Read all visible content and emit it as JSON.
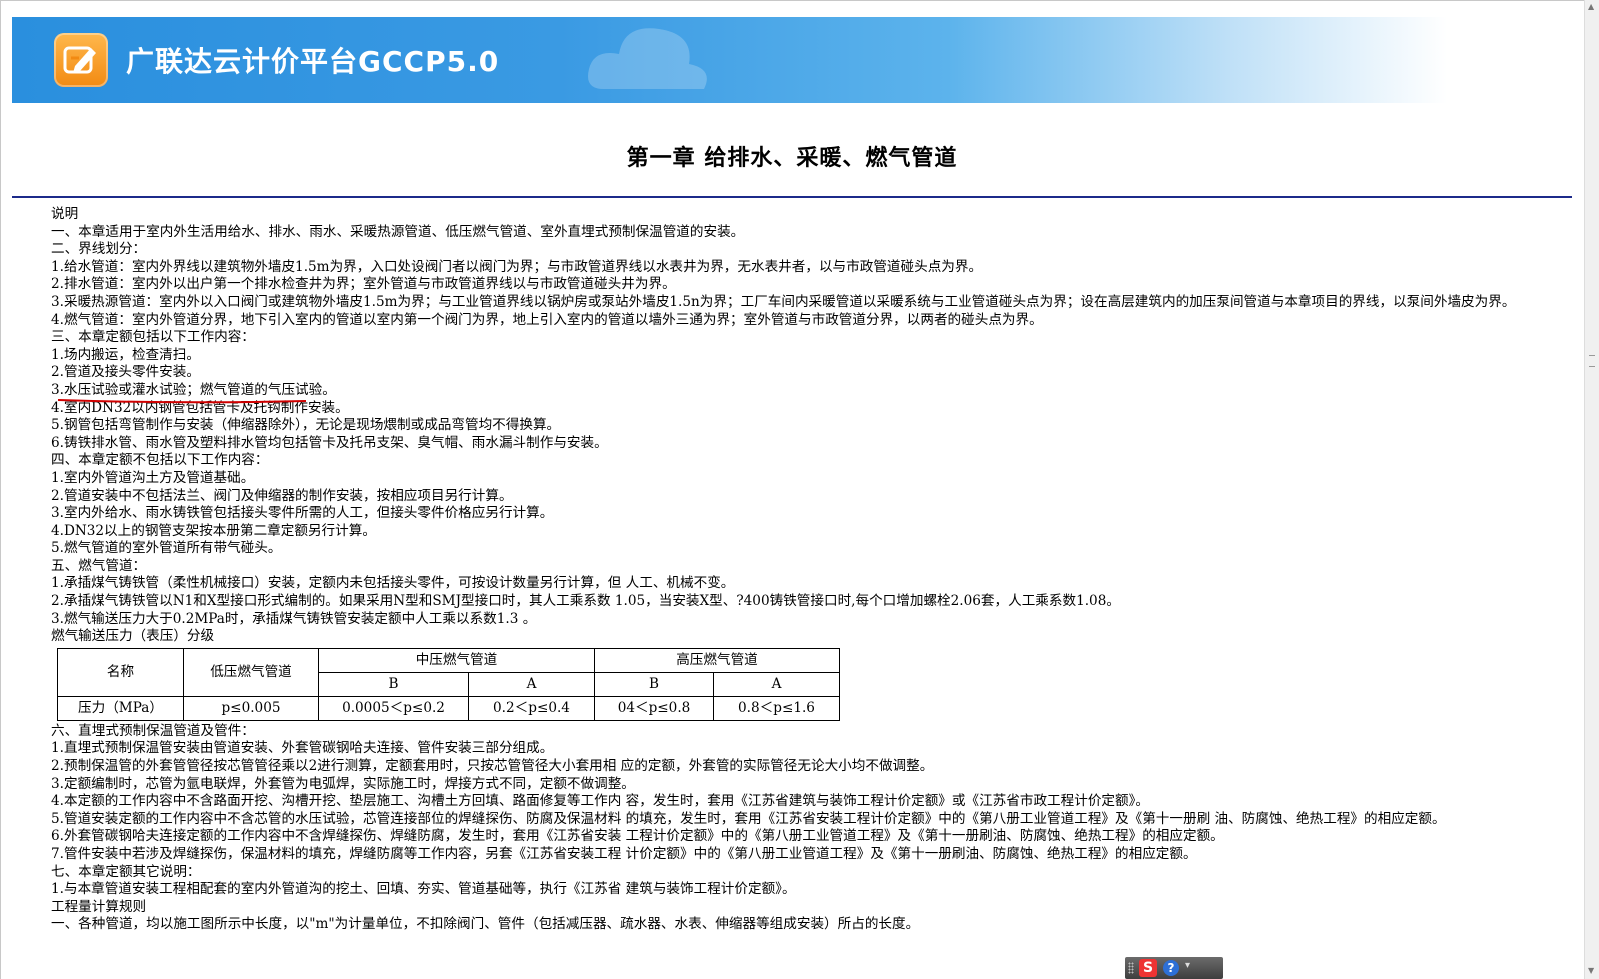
{
  "banner": {
    "title": "广联达云计价平台GCCP5.0"
  },
  "document": {
    "chapter_title": "第一章  给排水、采暖、燃气管道",
    "lines_before_table": [
      {
        "text": "说明"
      },
      {
        "text": "一、本章适用于室内外生活用给水、排水、雨水、采暖热源管道、低压燃气管道、室外直埋式预制保温管道的安装。"
      },
      {
        "text": "二、界线划分："
      },
      {
        "text": "1.给水管道：室内外界线以建筑物外墙皮1.5m为界，入口处设阀门者以阀门为界；与市政管道界线以水表井为界，无水表井者，以与市政管道碰头点为界。"
      },
      {
        "text": "2.排水管道：室内外以出户第一个排水检查井为界；室外管道与市政管道界线以与市政管道碰头井为界。"
      },
      {
        "text": "3.采暖热源管道：室内外以入口阀门或建筑物外墙皮1.5m为界；与工业管道界线以锅炉房或泵站外墙皮1.5n为界；工厂车间内采暖管道以采暖系统与工业管道碰头点为界；设在高层建筑内的加压泵间管道与本章项目的界线，以泵间外墙皮为界。",
        "wrap": true
      },
      {
        "text": "4.燃气管道：室内外管道分界，地下引入室内的管道以室内第一个阀门为界，地上引入室内的管道以墙外三通为界；室外管道与市政管道分界，以两者的碰头点为界。"
      },
      {
        "text": "三、本章定额包括以下工作内容："
      },
      {
        "text": "1.场内搬运，检查清扫。"
      },
      {
        "text": "2.管道及接头零件安装。"
      },
      {
        "text": "3.水压试验或灌水试验；燃气管道的气压试验。"
      },
      {
        "text": "4.室内DN32以内钢管包括管卡及托钩制作安装。"
      },
      {
        "text": "5.钢管包括弯管制作与安装（伸缩器除外），无论是现场煨制或成品弯管均不得换算。"
      },
      {
        "text": "6.铸铁排水管、雨水管及塑料排水管均包括管卡及托吊支架、臭气帽、雨水漏斗制作与安装。"
      },
      {
        "text": "四、本章定额不包括以下工作内容："
      },
      {
        "text": "1.室内外管道沟土方及管道基础。"
      },
      {
        "text": "2.管道安装中不包括法兰、阀门及伸缩器的制作安装，按相应项目另行计算。"
      },
      {
        "text": "3.室内外给水、雨水铸铁管包括接头零件所需的人工，但接头零件价格应另行计算。"
      },
      {
        "text": "4.DN32以上的钢管支架按本册第二章定额另行计算。"
      },
      {
        "text": "5.燃气管道的室外管道所有带气碰头。"
      },
      {
        "text": "五、燃气管道："
      },
      {
        "text": "1.承插煤气铸铁管（柔性机械接口）安装，定额内未包括接头零件，可按设计数量另行计算，但 人工、机械不变。"
      },
      {
        "text": "2.承插煤气铸铁管以N1和X型接口形式编制的。如果采用N型和SMJ型接口时，其人工乘系数 1.05，当安装X型、?400铸铁管接口时,每个口增加螺栓2.06套，人工乘系数1.08。"
      },
      {
        "text": "3.燃气输送压力大于0.2MPa时，承插煤气铸铁管安装定额中人工乘以系数1.3 。"
      },
      {
        "text": "燃气输送压力（表压）分级"
      }
    ],
    "pressure_table": {
      "h_name": "名称",
      "h_low": "低压燃气管道",
      "h_mid": "中压燃气管道",
      "h_high": "高压燃气管道",
      "mid_b": "B",
      "mid_a": "A",
      "high_b": "B",
      "high_a": "A",
      "row_label": "压力（MPa）",
      "low_val": "p≤0.005",
      "mid_b_val": "0.0005＜p≤0.2",
      "mid_a_val": "0.2＜p≤0.4",
      "high_b_val": "04＜p≤0.8",
      "high_a_val": "0.8＜p≤1.6"
    },
    "lines_after_table": [
      {
        "text": "六、直埋式预制保温管道及管件："
      },
      {
        "text": "1.直埋式预制保温管安装由管道安装、外套管碳钢哈夫连接、管件安装三部分组成。"
      },
      {
        "text": "2.预制保温管的外套管管径按芯管管径乘以2进行测算，定额套用时，只按芯管管径大小套用相 应的定额，外套管的实际管径无论大小均不做调整。"
      },
      {
        "text": "3.定额编制时，芯管为氩电联焊，外套管为电弧焊，实际施工时，焊接方式不同，定额不做调整。"
      },
      {
        "text": "4.本定额的工作内容中不含路面开挖、沟槽开挖、垫层施工、沟槽土方回填、路面修复等工作内 容，发生时，套用《江苏省建筑与装饰工程计价定额》或《江苏省市政工程计价定额》。"
      },
      {
        "text": "5.管道安装定额的工作内容中不含芯管的水压试验，芯管连接部位的焊缝探伤、防腐及保温材料 的填充，发生时，套用《江苏省安装工程计价定额》中的《第八册工业管道工程》及《第十一册刷 油、防腐蚀、绝热工程》的相应定额。",
        "wrap": true
      },
      {
        "text": "6.外套管碳钢哈夫连接定额的工作内容中不含焊缝探伤、焊缝防腐，发生时，套用《江苏省安装 工程计价定额》中的《第八册工业管道工程》及《第十一册刷油、防腐蚀、绝热工程》的相应定额。"
      },
      {
        "text": "7.管件安装中若涉及焊缝探伤，保温材料的填充，焊缝防腐等工作内容，另套《江苏省安装工程 计价定额》中的《第八册工业管道工程》及《第十一册刷油、防腐蚀、绝热工程》的相应定额。"
      },
      {
        "text": "七、本章定额其它说明："
      },
      {
        "text": "1.与本章管道安装工程相配套的室内外管道沟的挖土、回填、夯实、管道基础等，执行《江苏省 建筑与装饰工程计价定额》。"
      },
      {
        "text": "工程量计算规则"
      },
      {
        "text": "一、各种管道，均以施工图所示中长度，以\"m\"为计量单位，不扣除阀门、管件（包括减压器、疏水器、水表、伸缩器等组成安装）所占的长度。"
      }
    ]
  },
  "ime_toolbar": {
    "logo": "S",
    "help": "?",
    "dropdown": "▾"
  }
}
